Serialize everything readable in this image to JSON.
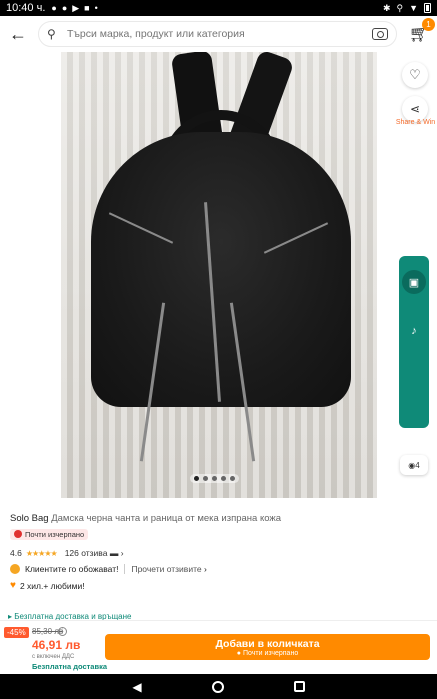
{
  "status": {
    "time": "10:40 ч."
  },
  "search": {
    "placeholder": "Търси марка, продукт или категория",
    "cart_count": "1"
  },
  "side": {
    "share_label": "Share & Win",
    "pay_badge": "4"
  },
  "product": {
    "brand": "Solo Bag",
    "name": "Дамска черна чанта и раница от мека изпрана кожа",
    "oos": "Почти изчерпано",
    "rating": "4.6",
    "stars": "★★★★★",
    "reviews": "126 отзива",
    "promo": "Клиентите го обожават!",
    "promo_link": "Прочети отзивите",
    "loves": "2 хил.+ любими!",
    "delivery_hint": "Безплатна доставка и връщане"
  },
  "price": {
    "discount": "-45%",
    "old": "85,30 лв",
    "new": "46,91 лв",
    "vat": "с включен ДДС",
    "free_shipping": "Безплатна доставка"
  },
  "cta": {
    "label": "Добави в количката",
    "sub": "Почти изчерпано"
  },
  "accent": {
    "orange": "#ff8a00",
    "teal": "#0f8a78",
    "red": "#ff5a2e"
  }
}
